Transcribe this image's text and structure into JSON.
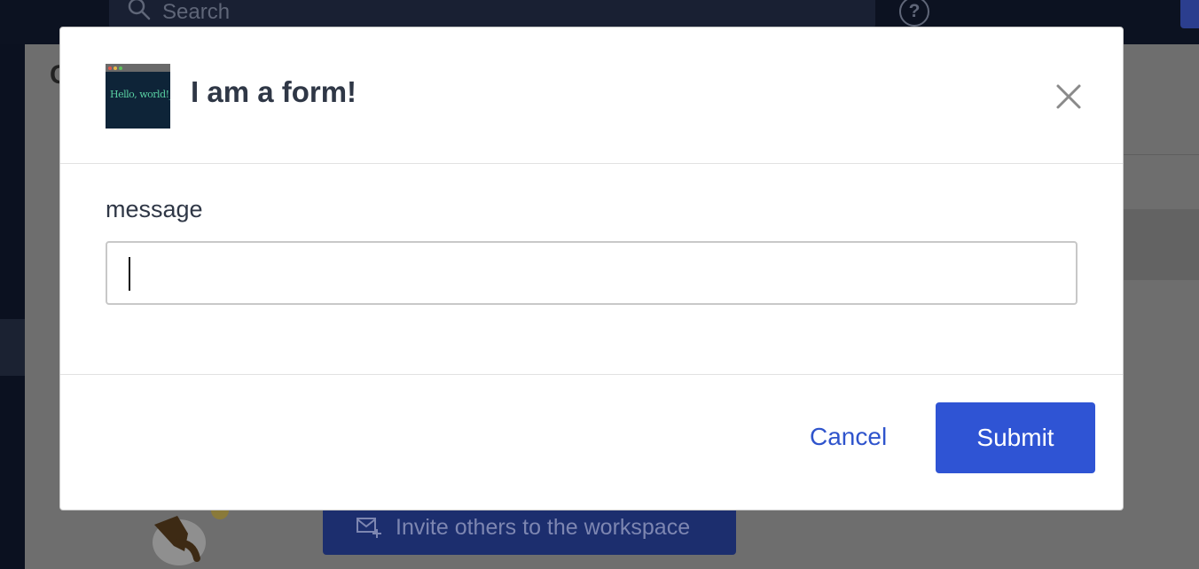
{
  "background": {
    "search": {
      "placeholder": "Search",
      "icon": "search-icon"
    },
    "help_icon": "help-circle-icon",
    "content_initial": "C",
    "invite_button": {
      "label": "Invite others to the workspace",
      "icon": "mail-plus-icon"
    }
  },
  "modal": {
    "logo": {
      "text": "Hello, world!_",
      "icon": "terminal-logo"
    },
    "title": "I am a form!",
    "close_icon": "close-icon",
    "field": {
      "label": "message",
      "value": ""
    },
    "cancel_label": "Cancel",
    "submit_label": "Submit"
  },
  "colors": {
    "overlay": "#6b6b6b",
    "primary": "#2f54d4",
    "link": "#2f54cc",
    "text": "#2f3746"
  }
}
